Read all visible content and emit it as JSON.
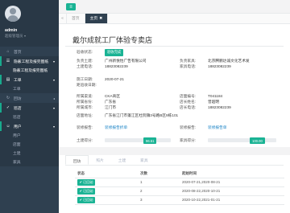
{
  "sidebar": {
    "username": "admin",
    "role": "超级管理员",
    "items": [
      {
        "icon": "home-icon",
        "glyph": "⌂",
        "label": "首页",
        "type": "top"
      },
      {
        "icon": "folder-icon",
        "glyph": "☰",
        "label": "隐蔽工程及报完图纸",
        "type": "parent",
        "open": true,
        "arrow": "▾"
      },
      {
        "label": "隐蔽工程及报完图纸",
        "type": "sub",
        "active": true
      },
      {
        "icon": "briefcase-icon",
        "glyph": "▤",
        "label": "工单",
        "type": "parent",
        "open": true,
        "arrow": "▾"
      },
      {
        "label": "工单",
        "type": "sub"
      },
      {
        "icon": "refresh-icon",
        "glyph": "↻",
        "label": "回访",
        "type": "top",
        "arrow": "◂"
      },
      {
        "icon": "check-icon",
        "glyph": "✓",
        "label": "巡店",
        "type": "parent",
        "open": true,
        "arrow": "▾"
      },
      {
        "label": "巡店",
        "type": "sub"
      },
      {
        "icon": "user-icon",
        "glyph": "☺",
        "label": "用户",
        "type": "parent",
        "open": true,
        "arrow": "▾"
      },
      {
        "label": "用户",
        "type": "sub"
      },
      {
        "label": "店面",
        "type": "sub"
      },
      {
        "label": "土建",
        "type": "sub"
      },
      {
        "label": "家具",
        "type": "sub"
      }
    ]
  },
  "topbar": {
    "menu_icon": "≡"
  },
  "tabs": {
    "back": "«",
    "items": [
      {
        "label": "首页",
        "active": false
      },
      {
        "label": "主页",
        "active": true,
        "close": "✖"
      }
    ]
  },
  "store": {
    "title": "戴尔成就工厂体验专卖店",
    "status_label": "验收状态:",
    "status_badge": "验收完成",
    "supervisor_label": "负责土建:",
    "supervisor_value": "广州新悦怡广告有限公司",
    "furniture_label": "负责家具:",
    "furniture_value": "北京腾鹏达诚文化艺术发",
    "phone1_label": "土建电话:",
    "phone1_value": "18823082239",
    "phone2_label": "家具电话:",
    "phone2_value": "18823082239",
    "start_label": "施工日期:",
    "start_value": "2020-07-21",
    "acceptance_label": "距验收日期:",
    "acceptance_value": "",
    "channel_label": "所属渠道:",
    "channel_value": "CKA商区",
    "code_label": "店面编号:",
    "code_value": "T041184",
    "province_label": "所属省份:",
    "province_value": "广东省",
    "manager_label": "店长姓名:",
    "manager_value": "曾超明",
    "city_label": "所属城市:",
    "city_value": "江门市",
    "mphone_label": "店长电话:",
    "mphone_value": "18823082239",
    "address_label": "店面地址:",
    "address_value": "广东省江门市蓬江区杜阮镇3号路B区9栋101",
    "img1_label": "装修报告:",
    "img1_link": "装修报告折单",
    "img2_label": "装修报告:",
    "img2_link": "装修报告单",
    "score1_label": "土建得分:",
    "score1_value": "96.51",
    "score2_label": "家具得分:",
    "score2_value": "100.00"
  },
  "detail_tabs": [
    "回访",
    "照片",
    "土建",
    "家具"
  ],
  "records": {
    "headers": [
      "状态",
      "次数",
      "起始时间"
    ],
    "rows": [
      {
        "status": "✔ 已回访",
        "count": "1",
        "range": "2020-07-21,2020-08-21"
      },
      {
        "status": "✔ 已回访",
        "count": "2",
        "range": "2020-08-22,2020-10-21"
      },
      {
        "status": "✔ 已回访",
        "count": "3",
        "range": "2020-10-22,2021-01-21"
      }
    ]
  }
}
